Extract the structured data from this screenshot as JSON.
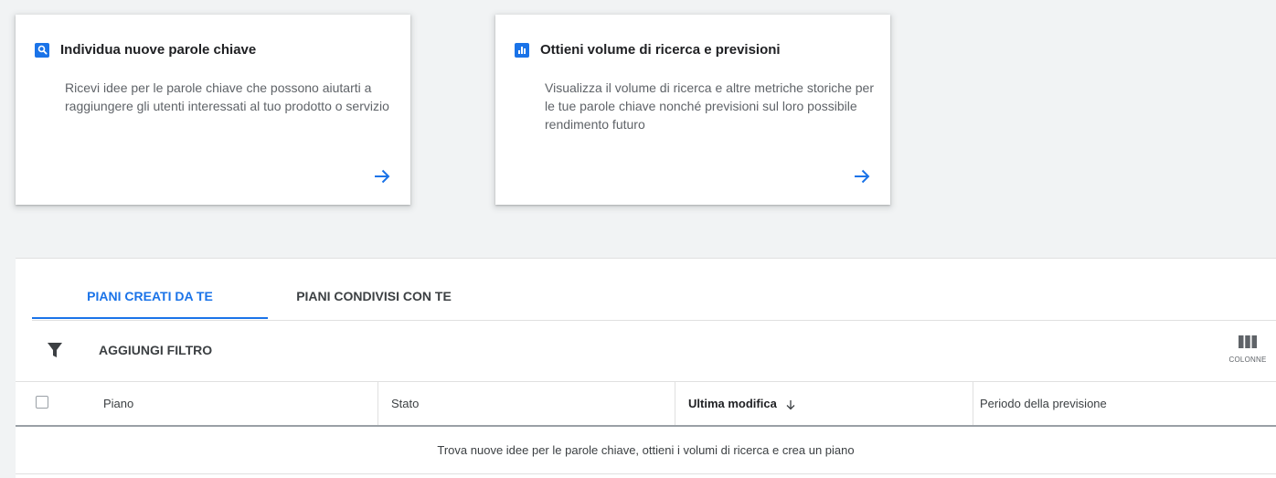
{
  "cards": [
    {
      "title": "Individua nuove parole chiave",
      "description": "Ricevi idee per le parole chiave che possono aiutarti a raggiungere gli utenti interessati al tuo prodotto o servizio",
      "icon": "search-icon"
    },
    {
      "title": "Ottieni volume di ricerca e previsioni",
      "description": "Visualizza il volume di ricerca e altre metriche storiche per le tue parole chiave nonché previsioni sul loro possibile rendimento futuro",
      "icon": "bar-chart-icon"
    }
  ],
  "tabs": [
    {
      "label": "PIANI CREATI DA TE",
      "active": true
    },
    {
      "label": "PIANI CONDIVISI CON TE",
      "active": false
    }
  ],
  "filter": {
    "label": "AGGIUNGI FILTRO",
    "icon": "filter-icon"
  },
  "columns_button": {
    "label": "COLONNE",
    "icon": "columns-icon"
  },
  "table": {
    "headers": [
      "Piano",
      "Stato",
      "Ultima modifica",
      "Periodo della previsione"
    ],
    "sort_column": "Ultima modifica",
    "sort_direction": "descending",
    "empty_message": "Trova nuove idee per le parole chiave, ottieni i volumi di ricerca e crea un piano"
  },
  "colors": {
    "accent": "#1a73e8",
    "background": "#f1f3f4"
  }
}
